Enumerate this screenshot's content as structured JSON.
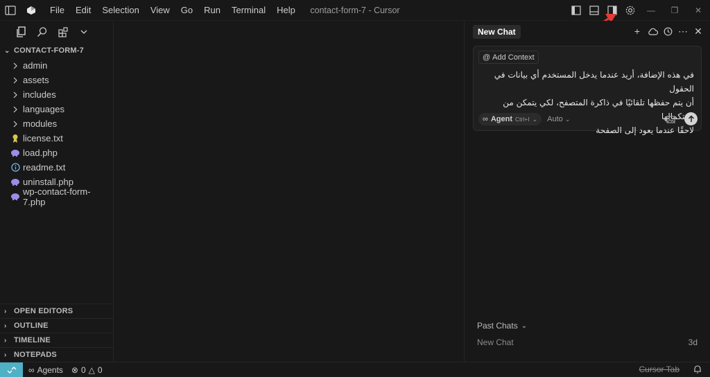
{
  "titlebar": {
    "menu": [
      "File",
      "Edit",
      "Selection",
      "View",
      "Go",
      "Run",
      "Terminal",
      "Help"
    ],
    "window_title": "contact-form-7 - Cursor"
  },
  "sidebar": {
    "project": "CONTACT-FORM-7",
    "items": [
      {
        "label": "admin",
        "type": "folder"
      },
      {
        "label": "assets",
        "type": "folder"
      },
      {
        "label": "includes",
        "type": "folder"
      },
      {
        "label": "languages",
        "type": "folder"
      },
      {
        "label": "modules",
        "type": "folder"
      },
      {
        "label": "license.txt",
        "type": "license"
      },
      {
        "label": "load.php",
        "type": "php"
      },
      {
        "label": "readme.txt",
        "type": "info"
      },
      {
        "label": "uninstall.php",
        "type": "php"
      },
      {
        "label": "wp-contact-form-7.php",
        "type": "php"
      }
    ],
    "sections": [
      "OPEN EDITORS",
      "OUTLINE",
      "TIMELINE",
      "NOTEPADS"
    ]
  },
  "chat": {
    "tab": "New Chat",
    "add_context": "Add Context",
    "prompt_lines": [
      "في هذه الإضافة، أريد عندما يدخل المستخدم أي بيانات في الحقول",
      "أن يتم حفظها تلقائيًا في ذاكرة المتصفح، لكي يتمكن من استكمالها",
      "لاحقًا عندما يعود إلى الصفحة"
    ],
    "agent_label": "Agent",
    "agent_shortcut": "Ctrl+I",
    "model": "Auto",
    "past_chats_label": "Past Chats",
    "past_chats": [
      {
        "title": "New Chat",
        "when": "3d"
      }
    ]
  },
  "statusbar": {
    "agents": "Agents",
    "errors": "0",
    "warnings": "0",
    "cursor_tab": "Cursor Tab"
  },
  "colors": {
    "background": "#181818",
    "accent_remote": "#4fb0c6",
    "arrow": "#e53935",
    "php_icon": "#9b8ee8"
  }
}
